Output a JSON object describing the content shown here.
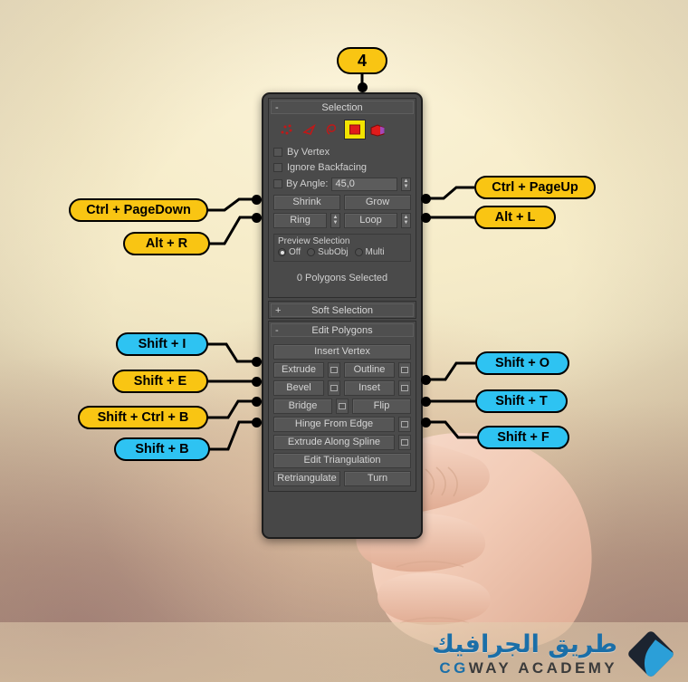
{
  "badge": {
    "label": "4"
  },
  "panel": {
    "rollouts": [
      {
        "id": "selection",
        "title": "Selection",
        "toggle": "-",
        "subobject_icons": [
          {
            "name": "vertex-icon",
            "active": false
          },
          {
            "name": "edge-icon",
            "active": false
          },
          {
            "name": "border-icon",
            "active": false
          },
          {
            "name": "polygon-icon",
            "active": true
          },
          {
            "name": "element-icon",
            "active": false
          }
        ],
        "checkboxes": [
          {
            "label": "By Vertex",
            "checked": false
          },
          {
            "label": "Ignore Backfacing",
            "checked": false
          }
        ],
        "angle": {
          "label": "By Angle:",
          "value": "45,0",
          "checked": false
        },
        "buttons": [
          {
            "label": "Shrink"
          },
          {
            "label": "Grow"
          },
          {
            "label": "Ring"
          },
          {
            "label": "Loop"
          }
        ],
        "preview": {
          "title": "Preview Selection",
          "options": [
            {
              "label": "Off",
              "selected": true
            },
            {
              "label": "SubObj",
              "selected": false
            },
            {
              "label": "Multi",
              "selected": false
            }
          ]
        },
        "status": "0 Polygons Selected"
      },
      {
        "id": "soft-selection",
        "title": "Soft Selection",
        "toggle": "+"
      },
      {
        "id": "edit-polygons",
        "title": "Edit Polygons",
        "toggle": "-",
        "buttons": [
          {
            "label": "Insert Vertex",
            "settings": false,
            "full": true
          },
          {
            "label": "Extrude",
            "settings": true
          },
          {
            "label": "Outline",
            "settings": true
          },
          {
            "label": "Bevel",
            "settings": true
          },
          {
            "label": "Inset",
            "settings": true
          },
          {
            "label": "Bridge",
            "settings": true
          },
          {
            "label": "Flip",
            "settings": false
          },
          {
            "label": "Hinge From Edge",
            "settings": true,
            "full": true
          },
          {
            "label": "Extrude Along Spline",
            "settings": true,
            "full": true
          },
          {
            "label": "Edit Triangulation",
            "settings": false,
            "full": true
          },
          {
            "label": "Retriangulate",
            "settings": false
          },
          {
            "label": "Turn",
            "settings": false
          }
        ]
      }
    ]
  },
  "callouts": {
    "left": [
      {
        "label": "Ctrl + PageDown",
        "color": "yellow"
      },
      {
        "label": "Alt + R",
        "color": "yellow"
      },
      {
        "label": "Shift + I",
        "color": "cyan"
      },
      {
        "label": "Shift + E",
        "color": "yellow"
      },
      {
        "label": "Shift + Ctrl + B",
        "color": "yellow"
      },
      {
        "label": "Shift + B",
        "color": "cyan"
      }
    ],
    "right": [
      {
        "label": "Ctrl + PageUp",
        "color": "yellow"
      },
      {
        "label": "Alt + L",
        "color": "yellow"
      },
      {
        "label": "Shift + O",
        "color": "cyan"
      },
      {
        "label": "Shift + T",
        "color": "cyan"
      },
      {
        "label": "Shift + F",
        "color": "cyan"
      }
    ]
  },
  "logo": {
    "arabic": "طريق الجرافيك",
    "cg": "CG",
    "academy": "WAY ACADEMY"
  },
  "colors": {
    "yellow": "#f9c513",
    "cyan": "#2ec3f2",
    "panel_bg": "#474747",
    "accent_select": "#f2e400"
  }
}
